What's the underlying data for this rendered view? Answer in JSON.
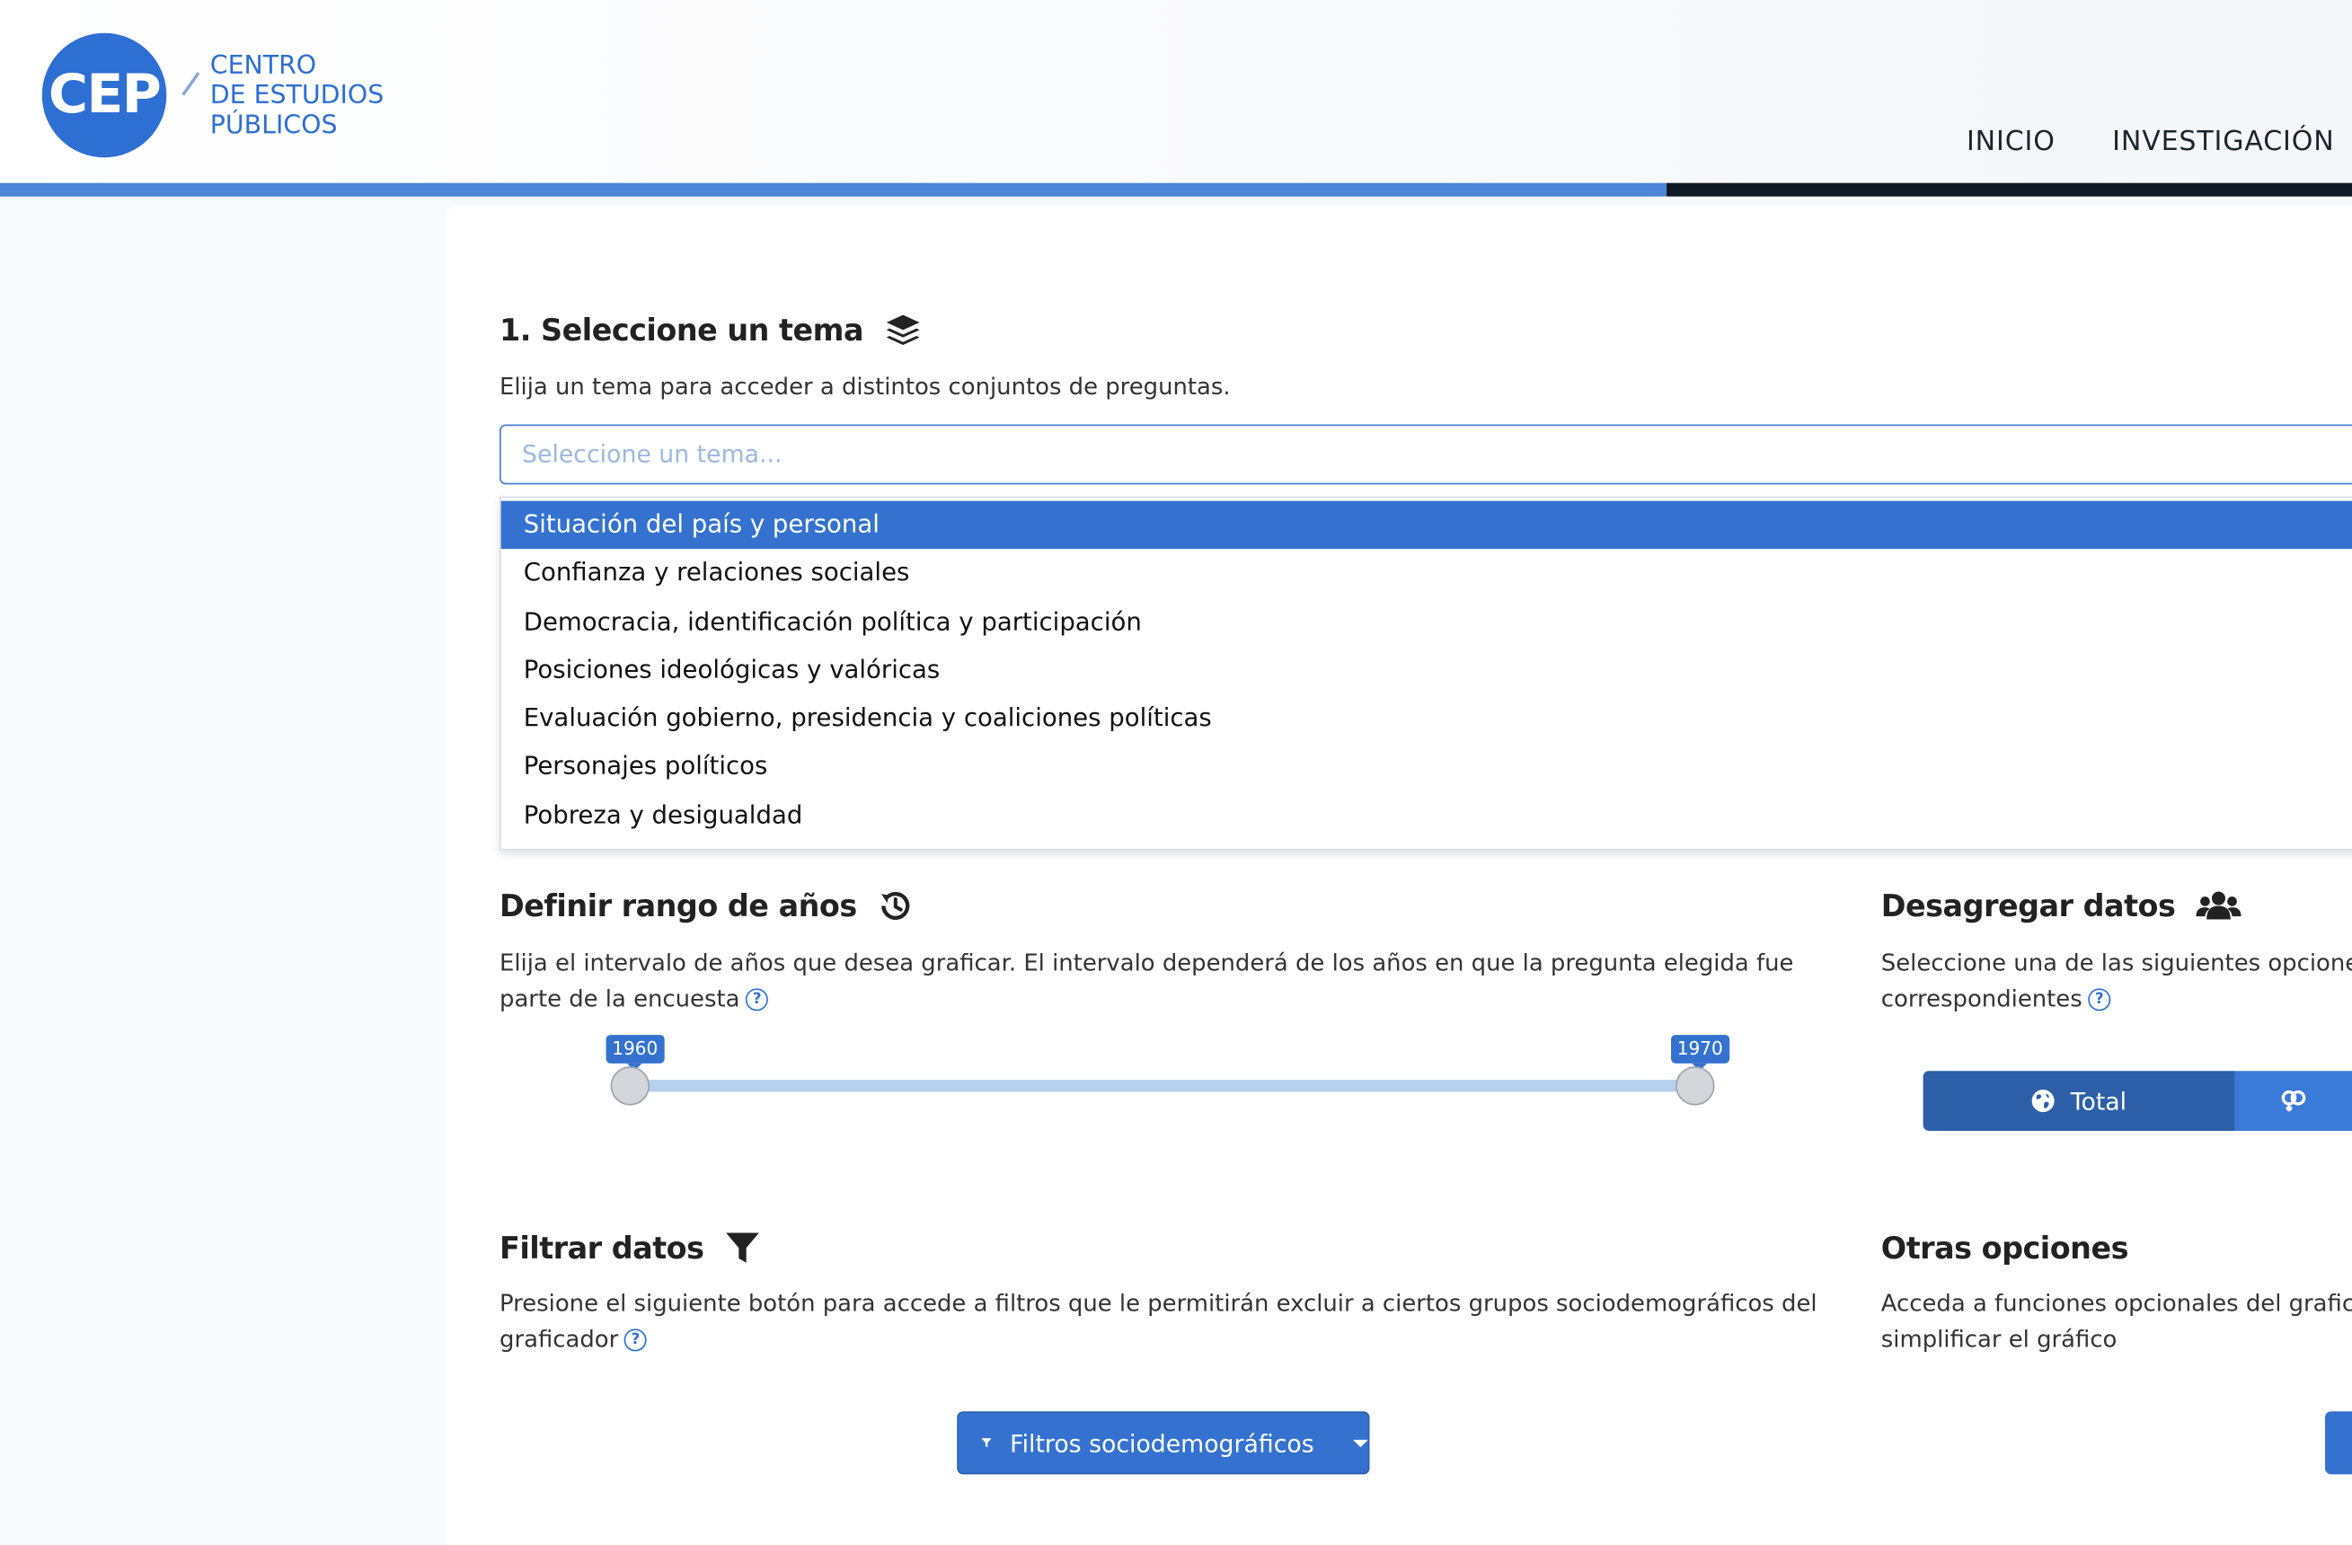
{
  "header": {
    "logo_mark": "CEP",
    "logo_line1": "CENTRO",
    "logo_line2": "DE ESTUDIOS",
    "logo_line3": "PÚBLICOS",
    "nav": [
      "INICIO",
      "INVESTIGACIÓN"
    ]
  },
  "tema": {
    "title": "1. Seleccione un tema",
    "description": "Elija un tema para acceder a distintos conjuntos de preguntas.",
    "placeholder": "Seleccione un tema...",
    "options": [
      "Situación del país y personal",
      "Confianza y relaciones sociales",
      "Democracia, identificación política y participación",
      "Posiciones ideológicas y valóricas",
      "Evaluación gobierno, presidencia y coaliciones políticas",
      "Personajes políticos",
      "Pobreza y desigualdad"
    ],
    "highlighted_index": 0
  },
  "rango": {
    "title": "Definir rango de años",
    "description": "Elija el intervalo de años que desea graficar. El intervalo dependerá de los años en que la pregunta elegida fue parte de la encuesta",
    "min_label": "1960",
    "max_label": "1970"
  },
  "desagregar": {
    "title": "Desagregar datos",
    "description": "Seleccione una de las siguientes opcione correspondientes",
    "total_label": "Total",
    "selected": "Total"
  },
  "filtrar": {
    "title": "Filtrar datos",
    "description": "Presione el siguiente botón para accede a filtros que le permitirán excluir a ciertos grupos sociodemográficos del graficador",
    "button_label": "Filtros sociodemográficos"
  },
  "otras": {
    "title": "Otras opciones",
    "description": "Acceda a funciones opcionales del grafic simplificar el gráfico"
  },
  "colors": {
    "brand_blue": "#2e6fd3",
    "highlight": "#3572cf",
    "dark_bar": "#0f1a26"
  }
}
